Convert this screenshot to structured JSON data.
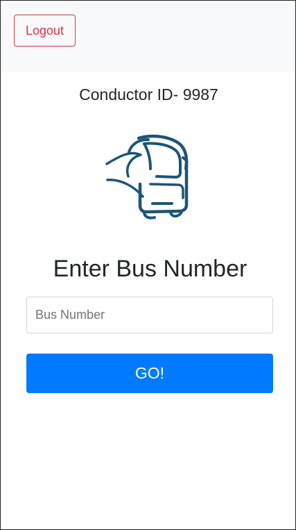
{
  "navbar": {
    "logout_label": "Logout"
  },
  "conductor": {
    "label": "Conductor ID-",
    "id": "9987"
  },
  "logo": {
    "icon": "bus-icon",
    "color": "#1d5575"
  },
  "form": {
    "heading": "Enter Bus Number",
    "input_placeholder": "Bus Number",
    "input_value": "",
    "submit_label": "GO!"
  },
  "colors": {
    "primary": "#007bff",
    "danger": "#dc3545",
    "navbar_bg": "#f8f9fa"
  }
}
